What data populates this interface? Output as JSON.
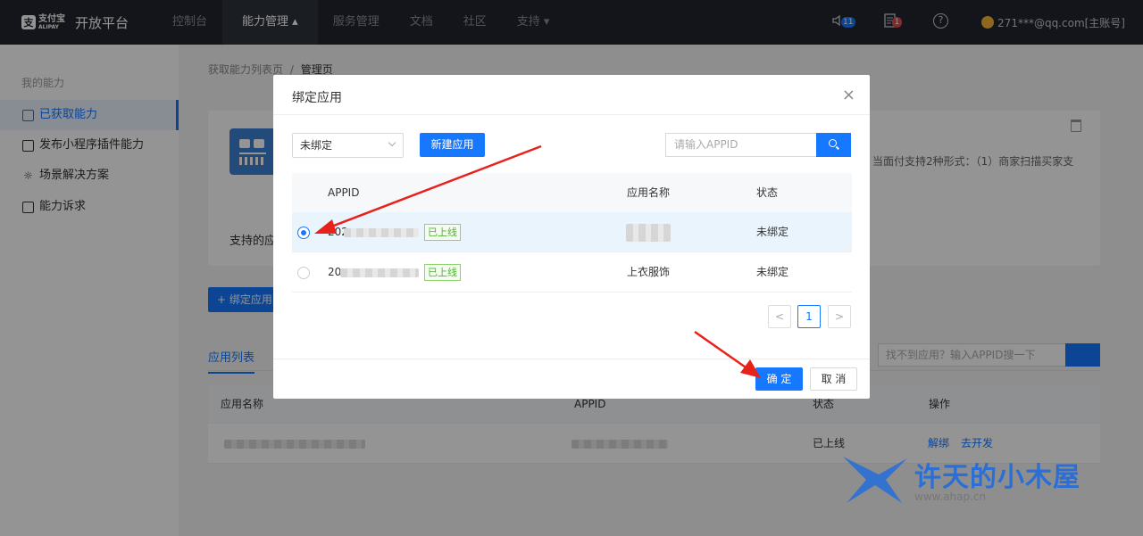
{
  "topnav": {
    "brand_logo_text": "支付宝",
    "brand_logo_sub": "ALIPAY",
    "brand_name": "开放平台",
    "items": [
      {
        "label": "控制台"
      },
      {
        "label": "能力管理 ▴"
      },
      {
        "label": "服务管理"
      },
      {
        "label": "文档"
      },
      {
        "label": "社区"
      },
      {
        "label": "支持 ▾"
      }
    ],
    "speaker_badge": "11",
    "message_badge": "1",
    "help_symbol": "?",
    "account": "271***@qq.com[主账号]"
  },
  "sidebar": {
    "title": "我的能力",
    "items": [
      {
        "label": "已获取能力"
      },
      {
        "label": "发布小程序插件能力"
      },
      {
        "label": "场景解决方案"
      },
      {
        "label": "能力诉求"
      }
    ]
  },
  "main": {
    "breadcrumb_parent": "获取能力列表页",
    "breadcrumb_sep": "/",
    "breadcrumb_current": "管理页",
    "card_desc": "当面付支持2种形式：（1）商家扫描买家支",
    "card_support_label": "支持的应用",
    "bind_app_button": "+ 绑定应用",
    "tab_label": "应用列表",
    "search_placeholder": "找不到应用？输入APPID搜一下",
    "table_headers": [
      "应用名称",
      "APPID",
      "状态",
      "操作"
    ],
    "row_status": "已上线",
    "row_action_unbind": "解绑",
    "row_action_dev": "去开发"
  },
  "modal": {
    "title": "绑定应用",
    "close_symbol": "×",
    "filter_selected": "未绑定",
    "new_app_button": "新建应用",
    "search_placeholder": "请输入APPID",
    "headers": {
      "appid": "APPID",
      "app_name": "应用名称",
      "status": "状态"
    },
    "rows": [
      {
        "appid_prefix": "202",
        "tag": "已上线",
        "app_name": "",
        "status": "未绑定",
        "selected": true
      },
      {
        "appid_prefix": "20",
        "tag": "已上线",
        "app_name": "上衣服饰",
        "status": "未绑定",
        "selected": false
      }
    ],
    "pagination": {
      "prev": "<",
      "current": "1",
      "next": ">"
    },
    "ok_button": "确 定",
    "cancel_button": "取 消"
  },
  "watermark": {
    "text": "许天的小木屋",
    "url": "www.ahap.cn"
  },
  "colors": {
    "accent": "#1677ff",
    "nav_bg": "#22252e",
    "annotation_arrow": "#e8221b",
    "online_tag": "#52b135"
  }
}
